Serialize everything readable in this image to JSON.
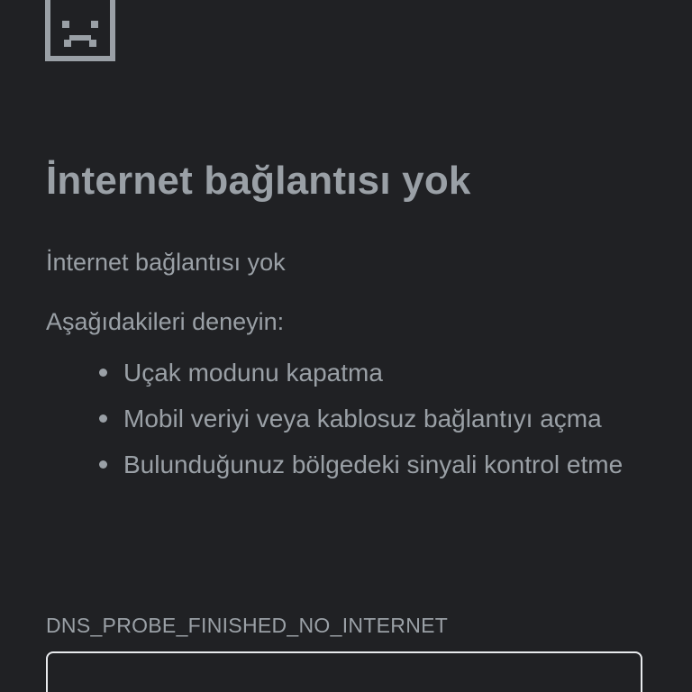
{
  "icon": "sad-page-icon",
  "colors": {
    "background": "#202124",
    "text": "#9aa0a6",
    "box_border": "#e8eaed"
  },
  "page": {
    "title": "İnternet bağlantısı yok",
    "subtitle": "İnternet bağlantısı yok",
    "try_label": "Aşağıdakileri deneyin:",
    "suggestions": [
      "Uçak modunu kapatma",
      "Mobil veriyi veya kablosuz bağlantıyı açma",
      "Bulunduğunuz bölgedeki sinyali kontrol etme"
    ],
    "error_code": "DNS_PROBE_FINISHED_NO_INTERNET"
  }
}
